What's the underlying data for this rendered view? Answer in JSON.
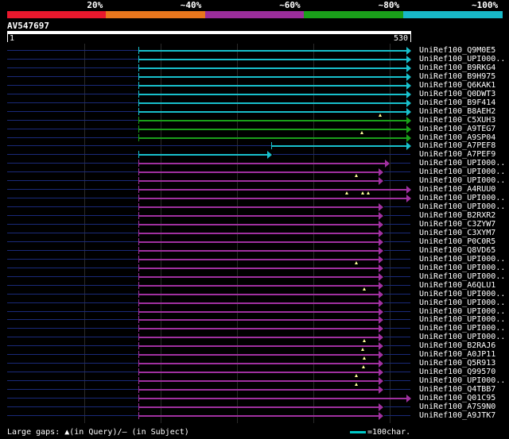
{
  "legend": {
    "segments": [
      {
        "label": "20%",
        "color": "#e8182d"
      },
      {
        "label": "~40%",
        "color": "#e8761d"
      },
      {
        "label": "~60%",
        "color": "#9b2d9b"
      },
      {
        "label": "~80%",
        "color": "#1aa01a"
      },
      {
        "label": "~100%",
        "color": "#18b8c8"
      }
    ]
  },
  "query": {
    "id": "AV547697",
    "start": "1",
    "end": "530"
  },
  "colors": {
    "cyan": "#18c0cc",
    "green": "#1aa01a",
    "purple": "#a030a0",
    "gap": "#ffff99"
  },
  "hits": [
    {
      "label": "UniRef100_Q9M0E5",
      "color": "cyan"
    },
    {
      "label": "UniRef100_UPI000..",
      "color": "cyan"
    },
    {
      "label": "UniRef100_B9RKG4",
      "color": "cyan"
    },
    {
      "label": "UniRef100_B9H975",
      "color": "cyan"
    },
    {
      "label": "UniRef100_Q6KAK1",
      "color": "cyan"
    },
    {
      "label": "UniRef100_Q0DWT3",
      "color": "cyan"
    },
    {
      "label": "UniRef100_B9F414",
      "color": "cyan"
    },
    {
      "label": "UniRef100_B8AEH2",
      "color": "cyan"
    },
    {
      "label": "UniRef100_C5XUH3",
      "color": "green"
    },
    {
      "label": "UniRef100_A9TEG7",
      "color": "green"
    },
    {
      "label": "UniRef100_A9SP04",
      "color": "green"
    },
    {
      "label": "UniRef100_A7PEF8",
      "color": "cyan"
    },
    {
      "label": "UniRef100_A7PEF9",
      "color": "cyan"
    },
    {
      "label": "UniRef100_UPI000..",
      "color": "purple"
    },
    {
      "label": "UniRef100_UPI000..",
      "color": "purple"
    },
    {
      "label": "UniRef100_UPI000..",
      "color": "purple"
    },
    {
      "label": "UniRef100_A4RUU0",
      "color": "purple"
    },
    {
      "label": "UniRef100_UPI000..",
      "color": "purple"
    },
    {
      "label": "UniRef100_UPI000..",
      "color": "purple"
    },
    {
      "label": "UniRef100_B2RXR2",
      "color": "purple"
    },
    {
      "label": "UniRef100_C3ZYW7",
      "color": "purple"
    },
    {
      "label": "UniRef100_C3XYM7",
      "color": "purple"
    },
    {
      "label": "UniRef100_P0C0R5",
      "color": "purple"
    },
    {
      "label": "UniRef100_Q8VD65",
      "color": "purple"
    },
    {
      "label": "UniRef100_UPI000..",
      "color": "purple"
    },
    {
      "label": "UniRef100_UPI000..",
      "color": "purple"
    },
    {
      "label": "UniRef100_UPI000..",
      "color": "purple"
    },
    {
      "label": "UniRef100_A6QLU1",
      "color": "purple"
    },
    {
      "label": "UniRef100_UPI000..",
      "color": "purple"
    },
    {
      "label": "UniRef100_UPI000..",
      "color": "purple"
    },
    {
      "label": "UniRef100_UPI000..",
      "color": "purple"
    },
    {
      "label": "UniRef100_UPI000..",
      "color": "purple"
    },
    {
      "label": "UniRef100_UPI000..",
      "color": "purple"
    },
    {
      "label": "UniRef100_UPI000..",
      "color": "purple"
    },
    {
      "label": "UniRef100_B2RAJ6",
      "color": "purple"
    },
    {
      "label": "UniRef100_A0JP11",
      "color": "purple"
    },
    {
      "label": "UniRef100_Q5R913",
      "color": "purple"
    },
    {
      "label": "UniRef100_Q99570",
      "color": "purple"
    },
    {
      "label": "UniRef100_UPI000..",
      "color": "purple"
    },
    {
      "label": "UniRef100_Q4TBB7",
      "color": "purple"
    },
    {
      "label": "UniRef100_Q01C95",
      "color": "purple"
    },
    {
      "label": "UniRef100_A7S9N0",
      "color": "purple"
    },
    {
      "label": "UniRef100_A9JTK7",
      "color": "purple"
    }
  ],
  "footer": {
    "gaps_text": "Large gaps: ▲(in Query)/– (in Subject)",
    "scale_text": "=100char."
  }
}
